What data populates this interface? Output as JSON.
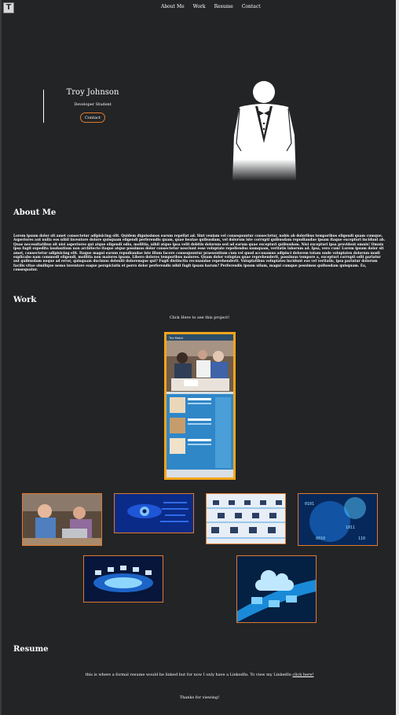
{
  "logo": {
    "letter": "T"
  },
  "nav": {
    "items": [
      "About Me",
      "Work",
      "Resume",
      "Contact"
    ]
  },
  "hero": {
    "name": "Troy Johnson",
    "subtitle": "Developer Student",
    "contact_label": "Contact"
  },
  "about": {
    "heading": "About Me",
    "body": "Lorem ipsum dolor sit amet consectetur adipisicing elit. Quidem dignissimos earum repellat ad. Sint veniam vel consequuntur consectetur, nobis ab doloribus temporibus eligendi quam cumque. Asperiores aut nulla eos nihil inventore dolore quisquam eligendi perferendis quam, quae beatae quibusdam, vel dolorum iste corrupti quibusdam repudiandae ipsam itaque excepturi incidunt ab. Quae necessitatibus sit nisi asperiores qui atque eligendi odio, mollitia, nihil atque ipsa velit debitis dolorum sed ad earum quae excepturi quibusdam. Nisi excepturi ipsa provident omnis! Omnis ipsa fugit expedita laudantium non architecto itaque atque possimus dolor consectetur nesciunt esse voluptate repellendus numquam, veritatis laborum ad. Ipsa, vero cum! Lorem ipsum dolor sit amet, consectetur adipisicing elit. Itaque magni earum repudiandae iste illum facere consequuntur praesentium cum vel quod accusamus adipisci dolorem totam unde voluptates dolorum modi explicabo nam commodi eligendi, mollitia non maiores ipsam. Libero dolores temporibus maiores. Quam dolor voluptas quae reprehenderit, possimus tempore a, excepturi corrupti odit pariatur aut quibusdam neque ad error, quisquam ducimus deleniti doloremque qui? Fugit distinctio recusandae reprehenderit. Voluptatibus voluptates incidunt eos vel veritatis, ipsa pariatur dolorum facilis vitae similique nemo inventore eaque perspiciatis et porro dolor perferendis nihil fugit ipsam harum? Perferendis ipsum ullam, magni cumque possimus quibusdam quisquam. Ea, consequatur."
  },
  "work": {
    "heading": "Work",
    "link_text": "Click Here to see this project!",
    "featured_site_title": "The Match"
  },
  "resume": {
    "heading": "Resume",
    "text": "this is where a formal resume would be linked but for now I only have a LinkedIn. To view my LinkedIn ",
    "link_label": "click here!"
  },
  "footer": {
    "thanks": "Thanks for viewing!"
  },
  "colors": {
    "background": "#232426",
    "accent": "#e07a2c",
    "featured_border": "#f4a51c"
  }
}
